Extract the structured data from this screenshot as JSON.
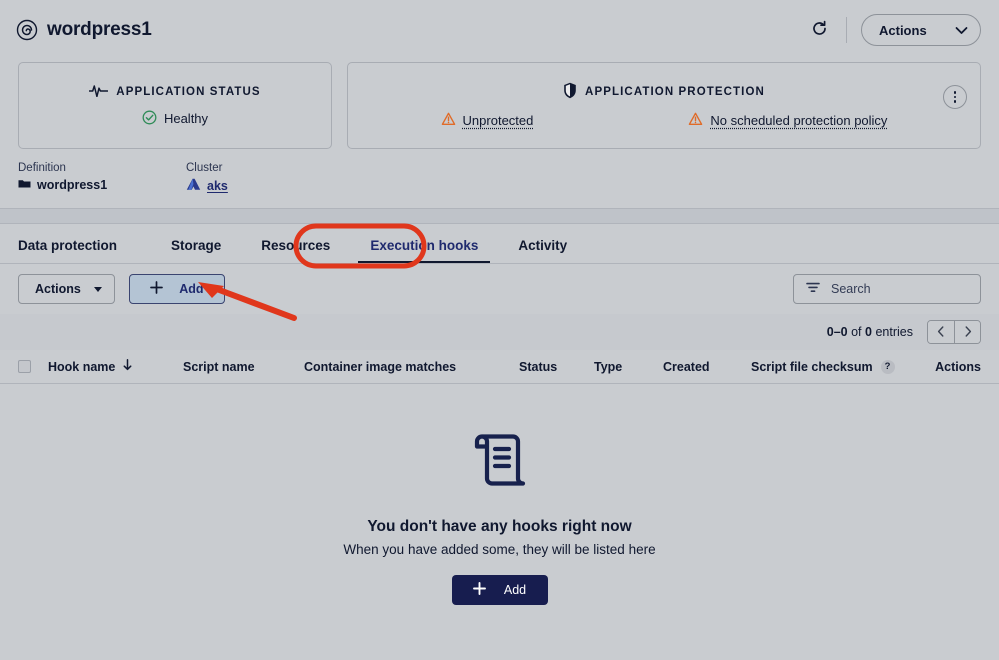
{
  "header": {
    "app_title": "wordpress1",
    "app_icon": "spiral-logo-icon",
    "refresh_icon": "refresh-icon",
    "actions_label": "Actions",
    "actions_caret_icon": "chevron-down-icon"
  },
  "cards": {
    "status": {
      "icon": "heartbeat-icon",
      "title": "APPLICATION STATUS",
      "value": "Healthy",
      "value_icon": "check-circle-icon",
      "value_color": "#2e8b57"
    },
    "protection": {
      "icon": "shield-icon",
      "title": "APPLICATION PROTECTION",
      "items": [
        {
          "label": "Unprotected",
          "icon": "warning-triangle-icon"
        },
        {
          "label": "No scheduled protection policy",
          "icon": "warning-triangle-icon"
        }
      ],
      "menu_icon": "kebab-menu-icon"
    }
  },
  "meta": [
    {
      "label": "Definition",
      "value": "wordpress1",
      "icon": "folder-icon",
      "is_link": false
    },
    {
      "label": "Cluster",
      "value": "aks",
      "icon": "cluster-triangle-icon",
      "is_link": true
    }
  ],
  "tabs": [
    {
      "label": "Data protection",
      "active": false
    },
    {
      "label": "Storage",
      "active": false
    },
    {
      "label": "Resources",
      "active": false
    },
    {
      "label": "Execution hooks",
      "active": true
    },
    {
      "label": "Activity",
      "active": false
    }
  ],
  "toolbar": {
    "actions_label": "Actions",
    "actions_caret_icon": "caret-down-icon",
    "add_label": "Add",
    "add_icon": "plus-icon",
    "search_placeholder": "Search",
    "search_value": "",
    "search_icon": "filter-funnel-icon"
  },
  "pagination": {
    "range_start": "0–0",
    "of_text": "of",
    "total": "0",
    "entries_word": "entries",
    "prev_icon": "chevron-left-icon",
    "next_icon": "chevron-right-icon"
  },
  "table": {
    "select_all_checkbox": "unchecked",
    "columns": [
      {
        "label": "Hook name",
        "sort": "desc",
        "sort_icon": "arrow-down-icon"
      },
      {
        "label": "Script name"
      },
      {
        "label": "Container image matches"
      },
      {
        "label": "Status"
      },
      {
        "label": "Type"
      },
      {
        "label": "Created"
      },
      {
        "label": "Script file checksum",
        "help_icon": "question-mark-icon",
        "help_label": "?"
      },
      {
        "label": "Actions"
      }
    ],
    "rows": []
  },
  "empty_state": {
    "icon": "scroll-document-icon",
    "title": "You don't have any hooks right now",
    "subtitle": "When you have added some, they will be listed here",
    "button_label": "Add",
    "button_icon": "plus-icon"
  },
  "annotations": {
    "ellipse": {
      "shape": "red-ellipse-highlight",
      "target": "Execution hooks"
    },
    "arrow": {
      "shape": "red-arrow",
      "target": "Add"
    },
    "color": "#e0371c"
  },
  "colors": {
    "page_background": "#c9ccd0",
    "accent_navy": "#171d4f",
    "link_navy": "#1f2a6e",
    "warning_orange": "#e06b28",
    "success_green": "#2e8b57",
    "annotation_red": "#e0371c"
  }
}
